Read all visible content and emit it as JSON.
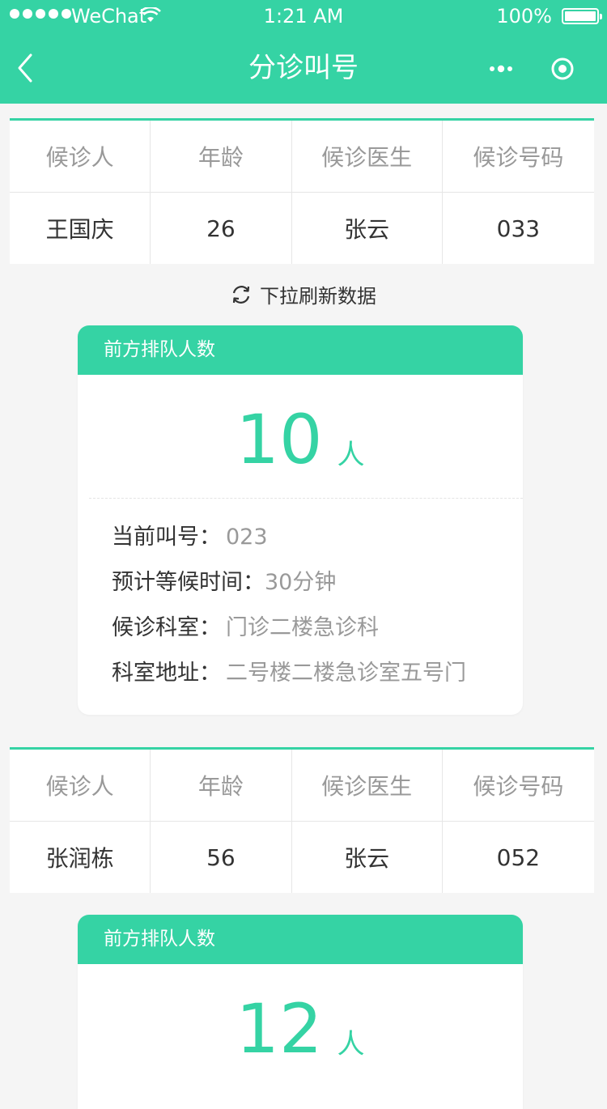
{
  "status_bar": {
    "carrier": "WeChat",
    "time": "1:21 AM",
    "battery": "100%"
  },
  "nav": {
    "title": "分诊叫号"
  },
  "table_headers": [
    "候诊人",
    "年龄",
    "候诊医生",
    "候诊号码"
  ],
  "refresh_hint": "下拉刷新数据",
  "patients": [
    {
      "name": "王国庆",
      "age": "26",
      "doctor": "张云",
      "number": "033",
      "queue": {
        "title": "前方排队人数",
        "count": "10",
        "unit": "人",
        "current_label": "当前叫号：",
        "current_value": "023",
        "wait_label": "预计等候时间：",
        "wait_value": "30分钟",
        "dept_label": "候诊科室：",
        "dept_value": "门诊二楼急诊科",
        "addr_label": "科室地址：",
        "addr_value": "二号楼二楼急诊室五号门"
      }
    },
    {
      "name": "张润栋",
      "age": "56",
      "doctor": "张云",
      "number": "052",
      "queue": {
        "title": "前方排队人数",
        "count": "12",
        "unit": "人"
      }
    }
  ],
  "colors": {
    "accent": "#35d3a4",
    "background": "#f5f5f5"
  }
}
